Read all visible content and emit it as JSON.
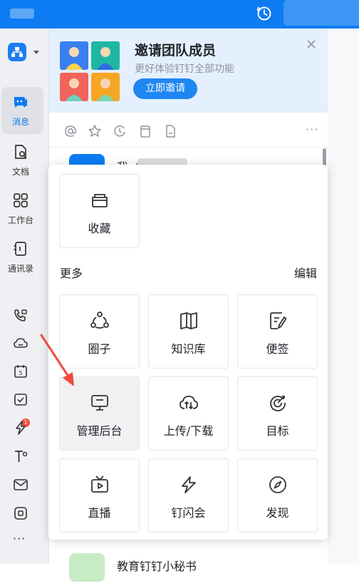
{
  "sidebar": {
    "items": [
      {
        "label": "消息",
        "icon": "chat-icon"
      },
      {
        "label": "文档",
        "icon": "document-icon"
      },
      {
        "label": "工作台",
        "icon": "workbench-icon"
      },
      {
        "label": "通讯录",
        "icon": "contacts-icon"
      }
    ],
    "extra_icons": [
      "phone-video-icon",
      "cloud-icon",
      "calendar-icon",
      "todo-icon",
      "lightning-icon",
      "text-tool-icon",
      "mail-icon",
      "app-icon",
      "more-icon"
    ],
    "calendar_day": "5",
    "todo_badge": "1",
    "more_label": "···"
  },
  "banner": {
    "title": "邀请团队成员",
    "subtitle": "更好体验钉钉全部功能",
    "button": "立即邀请"
  },
  "conversations": [
    {
      "name": "我（"
    },
    {
      "name": "教育钉钉小秘书"
    }
  ],
  "quick_more": "···",
  "popup": {
    "pinned": [
      {
        "label": "收藏",
        "icon": "favorites-icon"
      }
    ],
    "section_title": "更多",
    "edit_label": "编辑",
    "grid": [
      {
        "label": "圈子",
        "icon": "circle-icon"
      },
      {
        "label": "知识库",
        "icon": "knowledge-icon"
      },
      {
        "label": "便签",
        "icon": "note-icon"
      },
      {
        "label": "管理后台",
        "icon": "admin-console-icon"
      },
      {
        "label": "上传/下载",
        "icon": "cloud-transfer-icon"
      },
      {
        "label": "目标",
        "icon": "target-icon"
      },
      {
        "label": "直播",
        "icon": "live-tv-icon"
      },
      {
        "label": "钉闪会",
        "icon": "flash-meeting-icon"
      },
      {
        "label": "发现",
        "icon": "compass-icon"
      }
    ]
  },
  "colors": {
    "accent": "#0d7cf2",
    "badge": "#f54a45",
    "arrow": "#f24a3c"
  }
}
